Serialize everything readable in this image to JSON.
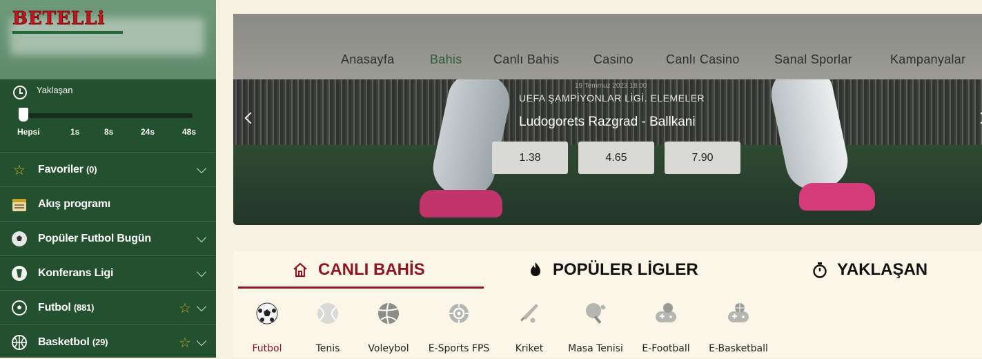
{
  "logo": {
    "text": "BETELLi"
  },
  "upcoming": {
    "title": "Yaklaşan",
    "ticks": [
      "Hepsi",
      "1s",
      "8s",
      "24s",
      "48s"
    ],
    "selected_index": 0
  },
  "sidebar": {
    "items": [
      {
        "label": "Favoriler",
        "count": "(0)",
        "icon": "star-icon",
        "has_star": false,
        "has_chevron": true
      },
      {
        "label": "Akış programı",
        "count": "",
        "icon": "calendar-icon",
        "has_star": false,
        "has_chevron": false
      },
      {
        "label": "Popüler Futbol Bugün",
        "count": "",
        "icon": "soccer-ball-icon",
        "has_star": false,
        "has_chevron": true
      },
      {
        "label": "Konferans Ligi",
        "count": "",
        "icon": "conference-league-icon",
        "has_star": false,
        "has_chevron": true
      },
      {
        "label": "Futbol",
        "count": "(881)",
        "icon": "soccer-ball-icon",
        "has_star": true,
        "has_chevron": true
      },
      {
        "label": "Basketbol",
        "count": "(29)",
        "icon": "basketball-icon",
        "has_star": true,
        "has_chevron": true
      }
    ]
  },
  "nav": {
    "items": [
      "Anasayfa",
      "Bahis",
      "Canlı Bahis",
      "Casino",
      "Canlı Casino",
      "Sanal Sporlar",
      "Kampanyalar"
    ],
    "active_index": 1
  },
  "banner": {
    "date": "19 Temmuz 2023 18:00",
    "league": "UEFA ŞAMPİYONLAR LİGİ.  ELEMELER",
    "match": "Ludogorets Razgrad  -  Ballkani",
    "odds": [
      "1.38",
      "4.65",
      "7.90"
    ]
  },
  "tabs": {
    "items": [
      "CANLI BAHİS",
      "POPÜLER LİGLER",
      "YAKLAŞAN"
    ],
    "active_index": 0
  },
  "sports": {
    "items": [
      "Futbol",
      "Tenis",
      "Voleybol",
      "E-Sports FPS",
      "Kriket",
      "Masa Tenisi",
      "E-Football",
      "E-Basketball"
    ],
    "active_index": 0
  },
  "colors": {
    "sidebar_bg": "#23502f",
    "accent_red": "#8f1621",
    "brand_red": "#c6161d",
    "nav_active": "#2f5e38"
  }
}
